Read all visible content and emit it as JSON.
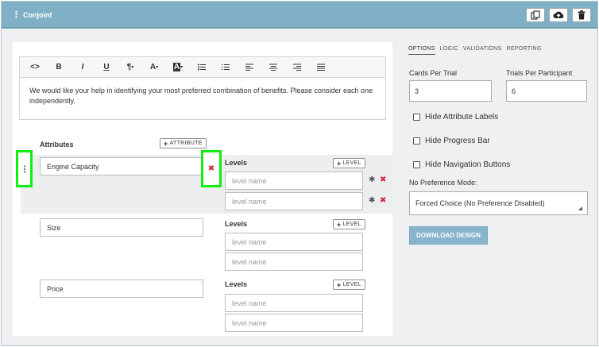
{
  "header": {
    "title": "Conjoint",
    "buttons": [
      "copy-icon",
      "cloud-upload-icon",
      "trash-icon"
    ]
  },
  "editor": {
    "toolbar": [
      "<>",
      "B",
      "I",
      "U",
      "¶",
      "A",
      "A",
      "list-ul",
      "list-ol",
      "align-left",
      "align-center",
      "align-right",
      "justify"
    ],
    "text": "We would like your help in identifying your most preferred combination of benefits. Please consider each one independently."
  },
  "attributes": {
    "label": "Attributes",
    "add_label": "ATTRIBUTE",
    "levels_label": "Levels",
    "add_level_label": "LEVEL",
    "level_placeholder": "level name",
    "items": [
      {
        "name": "Engine Capacity"
      },
      {
        "name": "Size"
      },
      {
        "name": "Price"
      }
    ]
  },
  "sidebar": {
    "tabs": [
      "OPTIONS",
      "LOGIC",
      "VALIDATIONS",
      "REPORTING"
    ],
    "cards_label": "Cards Per Trial",
    "cards_value": "3",
    "trials_label": "Trials Per Participant",
    "trials_value": "6",
    "checkboxes": [
      "Hide Attribute Labels",
      "Hide Progress Bar",
      "Hide Navigation Buttons"
    ],
    "no_pref_label": "No Preference Mode:",
    "no_pref_value": "Forced Choice (No Preference Disabled)",
    "download_label": "DOWNLOAD DESIGN"
  }
}
